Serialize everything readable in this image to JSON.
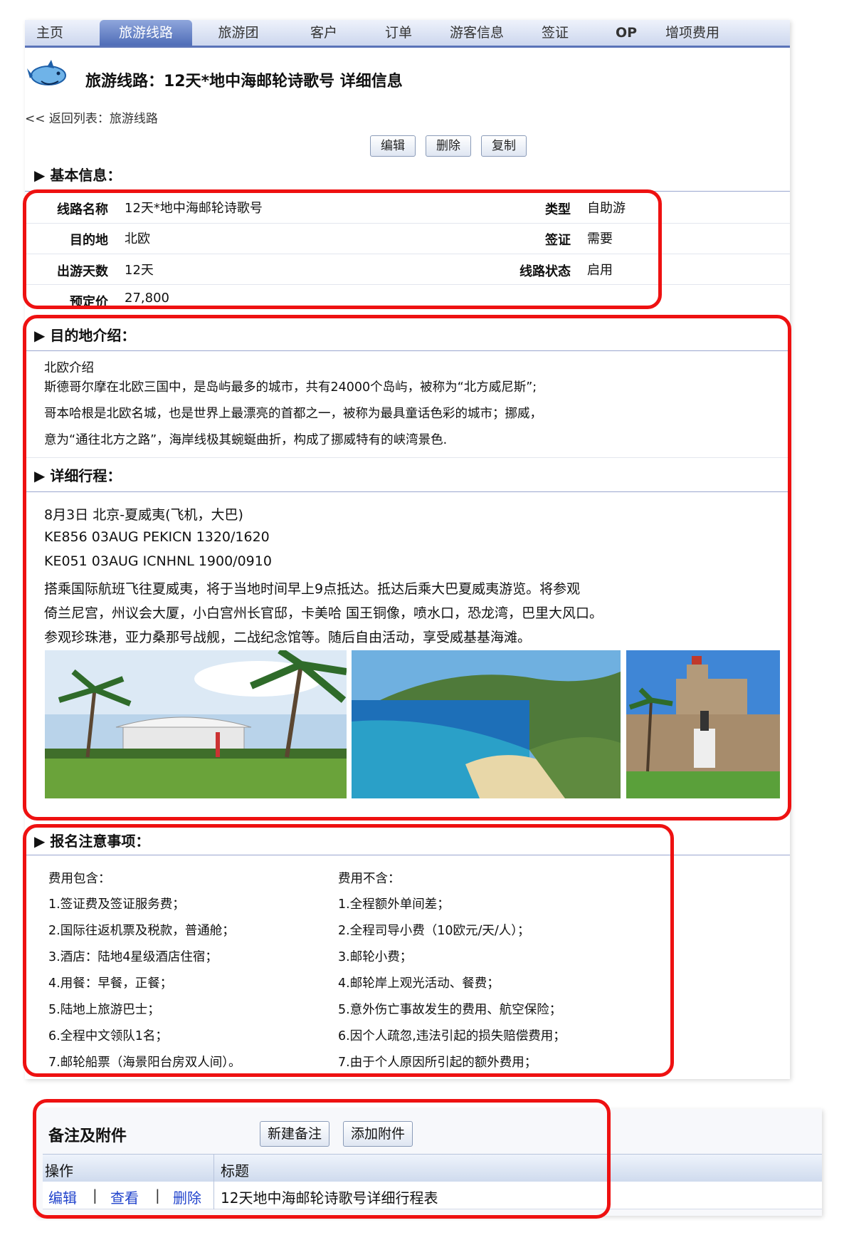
{
  "tabs": [
    "主页",
    "旅游线路",
    "旅游团",
    "客户",
    "订单",
    "游客信息",
    "签证",
    "OP",
    "增项费用"
  ],
  "active_tab": "旅游线路",
  "page_title": "旅游线路：12天*地中海邮轮诗歌号 详细信息",
  "back_link": "<< 返回列表：旅游线路",
  "actions": {
    "edit": "编辑",
    "delete": "删除",
    "copy": "复制"
  },
  "basic": {
    "heading": "基本信息：",
    "route_name_label": "线路名称",
    "route_name": "12天*地中海邮轮诗歌号",
    "type_label": "类型",
    "type": "自助游",
    "destination_label": "目的地",
    "destination": "北欧",
    "visa_label": "签证",
    "visa": "需要",
    "days_label": "出游天数",
    "days": "12天",
    "status_label": "线路状态",
    "status": "启用",
    "price_label": "预定价",
    "price": "27,800"
  },
  "destination_intro": {
    "heading": "目的地介绍：",
    "title": "北欧介绍",
    "lines": [
      "斯德哥尔摩在北欧三国中，是岛屿最多的城市，共有24000个岛屿，被称为“北方威尼斯”;",
      "哥本哈根是北欧名城，也是世界上最漂亮的首都之一，被称为最具童话色彩的城市；挪威，",
      "意为“通往北方之路”，海岸线极其蜿蜒曲折，构成了挪威特有的峡湾景色."
    ]
  },
  "itinerary": {
    "heading": "详细行程：",
    "lines": [
      "8月3日 北京-夏威夷(飞机，大巴)",
      "KE856 03AUG PEKICN 1320/1620",
      "KE051 03AUG ICNHNL 1900/0910",
      "搭乘国际航班飞往夏威夷，将于当地时间早上9点抵达。抵达后乘大巴夏威夷游览。将参观",
      "倚兰尼宫，州议会大厦，小白宫州长官邸，卡美哈 国王铜像，喷水口，恐龙湾，巴里大风口。",
      "参观珍珠港，亚力桑那号战舰，二战纪念馆等。随后自由活动，享受威基基海滩。"
    ]
  },
  "notes": {
    "heading": "报名注意事项：",
    "included_title": "费用包含：",
    "included": [
      "1.签证费及签证服务费；",
      "2.国际往返机票及税款，普通舱；",
      "3.酒店：陆地4星级酒店住宿；",
      "4.用餐：早餐，正餐；",
      "5.陆地上旅游巴士；",
      "6.全程中文领队1名；",
      "7.邮轮船票（海景阳台房双人间）。"
    ],
    "excluded_title": "费用不含：",
    "excluded": [
      "1.全程额外单间差；",
      "2.全程司导小费（10欧元/天/人）；",
      "3.邮轮小费；",
      "4.邮轮岸上观光活动、餐费；",
      "5.意外伤亡事故发生的费用、航空保险；",
      "6.因个人疏忽,违法引起的损失赔偿费用；",
      "7.由于个人原因所引起的额外费用；"
    ]
  },
  "attachments": {
    "title": "备注及附件",
    "new_note": "新建备注",
    "add_attachment": "添加附件",
    "col_ops": "操作",
    "col_title": "标题",
    "row": {
      "edit": "编辑",
      "view": "查看",
      "delete": "删除",
      "title": "12天地中海邮轮诗歌号详细行程表"
    }
  },
  "colors": {
    "highlight": "#ee1111",
    "tab_active": "#4f6db8",
    "link": "#2244cc"
  }
}
